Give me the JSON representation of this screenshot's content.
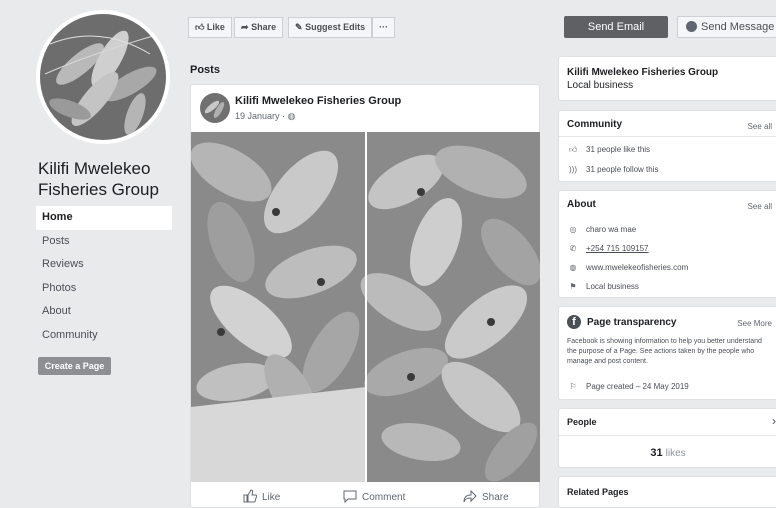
{
  "page": {
    "name_line1": "Kilifi Mwelekeo",
    "name_line2": "Fisheries Group"
  },
  "left_nav": [
    {
      "label": "Home"
    },
    {
      "label": "Posts"
    },
    {
      "label": "Reviews"
    },
    {
      "label": "Photos"
    },
    {
      "label": "About"
    },
    {
      "label": "Community"
    }
  ],
  "create_page_label": "Create a Page",
  "action_bar": {
    "like": "Like",
    "share": "Share",
    "suggest": "Suggest Edits",
    "more": "···",
    "send_email": "Send Email",
    "send_message": "Send Message"
  },
  "posts": {
    "title": "Posts",
    "post": {
      "author": "Kilifi Mwelekeo Fisheries Group",
      "date": "19 January · ",
      "like": "Like",
      "comment": "Comment",
      "share": "Share"
    }
  },
  "info_card": {
    "name": "Kilifi Mwelekeo Fisheries Group",
    "category": "Local business"
  },
  "community": {
    "title": "Community",
    "see_all": "See all",
    "likes": "31 people like this",
    "follows": "31 people follow this"
  },
  "about": {
    "title": "About",
    "see_all": "See all",
    "location": "charo wa mae",
    "phone": "+254 715 109157",
    "website": "www.mwelekeofisheries.com",
    "category": "Local business"
  },
  "transparency": {
    "title": "Page transparency",
    "see_more": "See More",
    "desc": "Facebook is showing information to help you better understand the purpose of a Page. See actions taken by the people who manage and post content.",
    "created": "Page created – 24 May 2019"
  },
  "people": {
    "title": "People",
    "likes_count": "31",
    "likes_word": "likes"
  },
  "related": {
    "title": "Related Pages"
  },
  "colors": {
    "background": "#e9eaec",
    "send_email_bg": "#5e6064",
    "card_bg": "#ffffff"
  }
}
